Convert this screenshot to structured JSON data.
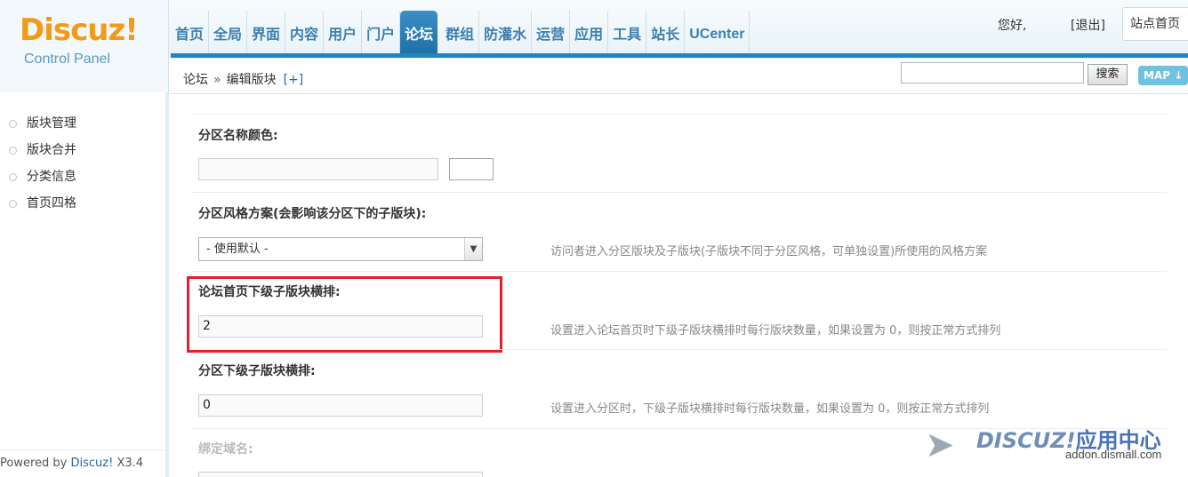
{
  "header": {
    "logo_brand": "Discuz!",
    "logo_sub": "Control Panel",
    "nav": [
      {
        "label": "首页"
      },
      {
        "label": "全局"
      },
      {
        "label": "界面"
      },
      {
        "label": "内容"
      },
      {
        "label": "用户"
      },
      {
        "label": "门户"
      },
      {
        "label": "论坛",
        "active": true
      },
      {
        "label": "群组"
      },
      {
        "label": "防灌水"
      },
      {
        "label": "运营"
      },
      {
        "label": "应用"
      },
      {
        "label": "工具"
      },
      {
        "label": "站长"
      },
      {
        "label": "UCenter"
      }
    ],
    "greeting": "您好,",
    "logout": "[退出]",
    "site_home": "站点首页"
  },
  "subbar": {
    "breadcrumb_root": "论坛",
    "breadcrumb_sep": "»",
    "breadcrumb_current": "编辑版块",
    "breadcrumb_plus": "[+]",
    "search_placeholder": "",
    "search_button": "搜索",
    "map_button": "MAP ↓"
  },
  "sidebar": {
    "items": [
      {
        "label": "版块管理"
      },
      {
        "label": "版块合并"
      },
      {
        "label": "分类信息"
      },
      {
        "label": "首页四格"
      }
    ],
    "powered_prefix": "Powered by ",
    "powered_brand": "Discuz!",
    "powered_version": " X3.4"
  },
  "form": {
    "name_color_label": "分区名称颜色:",
    "name_color_value": "",
    "style_label": "分区风格方案(会影响该分区下的子版块):",
    "style_selected": "- 使用默认 -",
    "style_tip": "访问者进入分区版块及子版块(子版块不同于分区风格，可单独设置)所使用的风格方案",
    "index_sub_label": "论坛首页下级子版块横排:",
    "index_sub_value": "2",
    "index_sub_tip": "设置进入论坛首页时下级子版块横排时每行版块数量，如果设置为 0，则按正常方式排列",
    "cat_sub_label": "分区下级子版块横排:",
    "cat_sub_value": "0",
    "cat_sub_tip": "设置进入分区时，下级子版块横排时每行版块数量，如果设置为 0，则按正常方式排列",
    "domain_label": "绑定域名:"
  },
  "watermark": {
    "brand": "DISCUZ!",
    "cn": "应用中心",
    "url": "addon.dismall.com"
  },
  "colors": {
    "accent": "#1f86bf",
    "highlight": "#e0202a",
    "logo_orange": "#f29b19"
  }
}
